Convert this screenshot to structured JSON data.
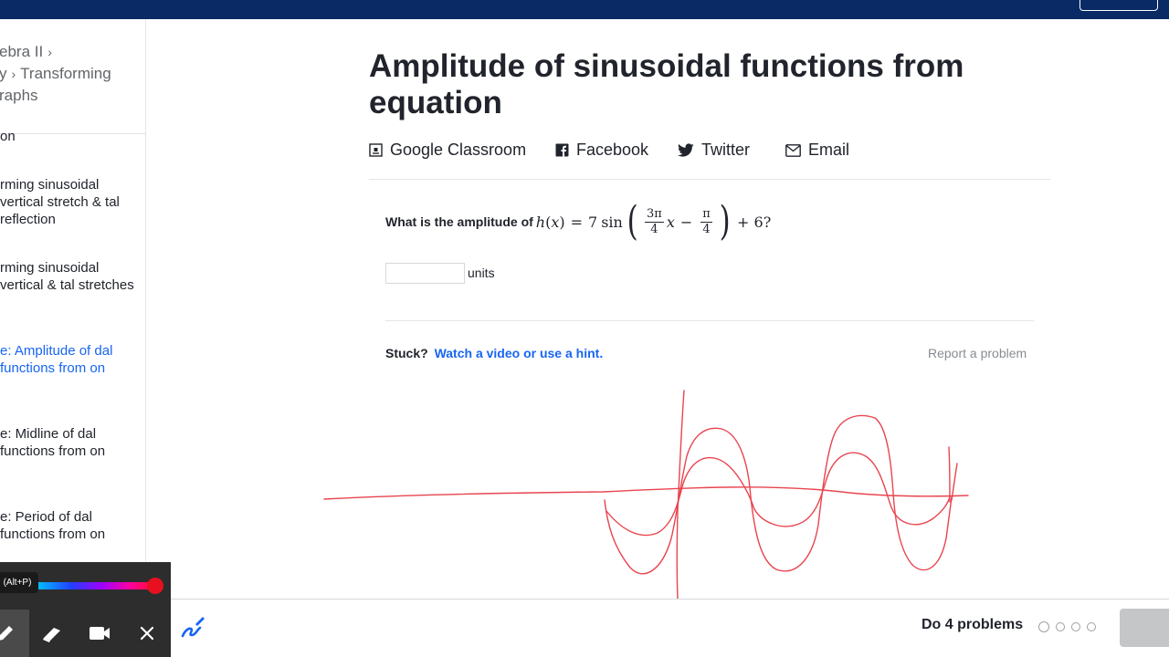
{
  "header": {},
  "breadcrumb": {
    "part1": "ebra II",
    "part2": "y",
    "part3": "Transforming",
    "part4": "raphs"
  },
  "sidebar": {
    "items": [
      {
        "label": "on"
      },
      {
        "label": "rming sinusoidal vertical stretch & tal reflection"
      },
      {
        "label": "rming sinusoidal vertical & tal stretches"
      },
      {
        "label": "e: Amplitude of dal functions from on"
      },
      {
        "label": "e: Midline of dal functions from on"
      },
      {
        "label": "e: Period of dal functions from on"
      }
    ]
  },
  "page": {
    "title": "Amplitude of sinusoidal functions from equation"
  },
  "share": {
    "classroom": "Google Classroom",
    "facebook": "Facebook",
    "twitter": "Twitter",
    "email": "Email"
  },
  "question": {
    "label": "What is the amplitude of",
    "func": "h",
    "var": "x",
    "coef": "7",
    "trig": "sin",
    "frac1_num": "3π",
    "frac1_den": "4",
    "frac2_num": "π",
    "frac2_den": "4",
    "tail": "+ 6?"
  },
  "answer": {
    "value": "",
    "units": "units"
  },
  "help": {
    "stuck": "Stuck?",
    "link": "Watch a video or use a hint.",
    "report": "Report a problem"
  },
  "footer": {
    "do_problems": "Do 4 problems",
    "progress": {
      "completed": 0,
      "total": 4
    }
  },
  "annotation_toolbar": {
    "tooltip": "(Alt+P)",
    "pen_color": "#e81020",
    "tools": [
      "pen-icon",
      "eraser-icon",
      "camera-icon",
      "close-icon"
    ]
  },
  "colors": {
    "accent": "#1865f2",
    "topbar": "#0a2a66",
    "ink": "#e8454f"
  }
}
